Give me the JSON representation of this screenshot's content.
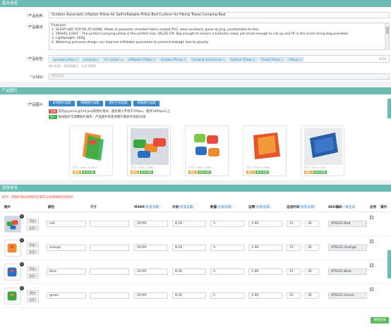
{
  "sections": {
    "basic": "基本信息",
    "images": "产品图片",
    "variants": "变体信息"
  },
  "basic": {
    "title_label": "产品名称:",
    "title_value": "Outdoor Automatic Inflation Pillow Air Self-Inflatable Pillow Bed Cushion for Hiking Travel Camping Rest",
    "desc_label": "产品描述:",
    "desc_lines": [
      "Features:",
      "1. SLEEP LIKE YOU'RE AT HOME: Made of polyester checked fabric coated PVC, wear-resistant, quick-drying, comfortable to feel.",
      "2. TRAVEL LIGHT - The perfect camping pillow is the perfect size, 50x25 CM. Big enough to ensure a fantastic sleep yet small enough to roll up and fit in the small string bag provided.",
      "3. Lightweight: 260g",
      "4. Widening pressure design can improve inflatable guarantee to prevent leakage due to gravity."
    ],
    "tags_label": "产品标签:",
    "tags": [
      "portable pillow",
      "camping",
      "Air cushion",
      "Inflatable Pillows",
      "Outdoor Pillows",
      "Camping Accessories",
      "Outdoor Pillows",
      "Throw Pillows",
      "Pillows"
    ],
    "tag_count": "9/10",
    "tags_hint": "输入标签，按回车确认，点击可删除",
    "sku_label": "父SKU:",
    "sku_value": "ATII222"
  },
  "images": {
    "label": "产品图片:",
    "buttons": [
      "本地图片选取",
      "网络图片选取",
      "图片空间选取",
      "采集图片选取"
    ],
    "note1_badge": "注意",
    "note1": "支持jpg,bmp,gif,tif,png等图片格式，图片最小不低于500px，推荐1000px以上",
    "note2_badge": "提示",
    "note2": "拖动图片可调整图片顺序，产品图片和变体图片最多可添加20张",
    "cards": [
      {
        "size": "尺寸: 1001 × 1001",
        "color": "#f08a2c"
      },
      {
        "size": "尺寸: 1100 × 800",
        "color": "#3aa640"
      },
      {
        "size": "尺寸: 1100 × 800",
        "color": "#7ac943"
      },
      {
        "size": "尺寸: 1100 × 800",
        "color": "#e8552a"
      },
      {
        "size": "尺寸: 225 × 225",
        "color": "#2a5fa8"
      }
    ],
    "card_actions": [
      "删除",
      "作为主图"
    ]
  },
  "variants": {
    "tip": "提示：把图片拖动到图片区域可以快速替换变体图片",
    "headers": {
      "image": "图片",
      "color": "颜色",
      "size": "尺寸",
      "msrp": "MSRP",
      "price": "价格",
      "qty": "数量",
      "ship": "运费",
      "days": "运送时间",
      "sku": "SKU编码",
      "enabled": "启用",
      "op": "操作"
    },
    "batch": "(批量设置)",
    "sku_extra": "一键生成",
    "add_label": "添加+",
    "apply_label": "应用+",
    "rows": [
      {
        "color": "red",
        "msrp": "29.99",
        "price": "8.29",
        "qty": "3",
        "ship": "1.99",
        "days_from": "15",
        "days_to": "30",
        "sku": "ATII222-Red",
        "img": "#e74c3c"
      },
      {
        "color": "orange",
        "msrp": "29.99",
        "price": "8.29",
        "qty": "5",
        "ship": "1.99",
        "days_from": "15",
        "days_to": "30",
        "sku": "ATII222-Orange",
        "img": "#f08a2c"
      },
      {
        "color": "blue",
        "msrp": "29.99",
        "price": "8.29",
        "qty": "5",
        "ship": "1.99",
        "days_from": "15",
        "days_to": "30",
        "sku": "ATII222-Blue",
        "img": "#2a6fc4"
      },
      {
        "color": "green",
        "msrp": "29.99",
        "price": "8.29",
        "qty": "5",
        "ship": "1.99",
        "days_from": "15",
        "days_to": "30",
        "sku": "ATII222-Green",
        "img": "#3aa640"
      }
    ],
    "add_variant": "添加变体"
  }
}
